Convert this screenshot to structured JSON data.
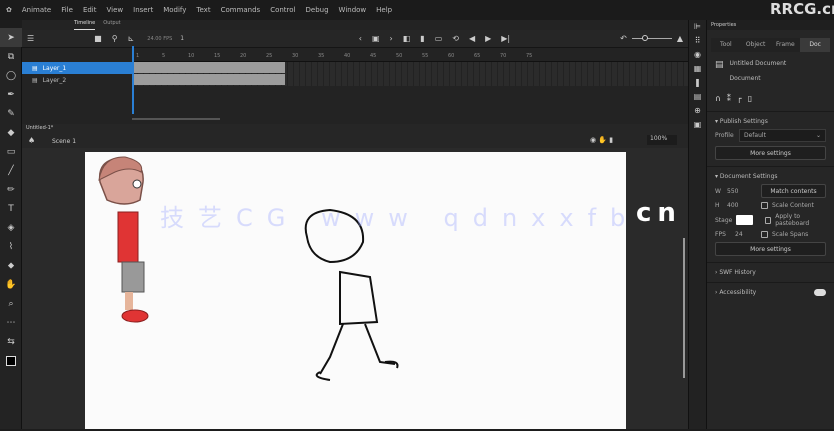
{
  "menu": {
    "app": "Animate",
    "items": [
      "File",
      "Edit",
      "View",
      "Insert",
      "Modify",
      "Text",
      "Commands",
      "Control",
      "Debug",
      "Window",
      "Help"
    ]
  },
  "timeline": {
    "tabs": [
      "Timeline",
      "Output"
    ],
    "fps": "24.00 FPS",
    "frame": "1",
    "frame_numbers": [
      "1",
      "5",
      "10",
      "15",
      "20",
      "25",
      "30",
      "35",
      "40",
      "45",
      "50",
      "55",
      "60",
      "65",
      "70",
      "75"
    ],
    "layers": [
      {
        "name": "Layer_1",
        "selected": true
      },
      {
        "name": "Layer_2",
        "selected": false
      }
    ]
  },
  "stage": {
    "doc_tab": "Untitled-1*",
    "scene": "Scene 1",
    "zoom": "100%"
  },
  "properties": {
    "title": "Properties",
    "tabs": [
      "Tool",
      "Object",
      "Frame",
      "Doc"
    ],
    "active_tab": "Doc",
    "doc_name": "Untitled Document",
    "doc_type": "Document",
    "publish_section": "Publish Settings",
    "profile_label": "Profile",
    "profile_value": "Default",
    "more_settings": "More settings",
    "doc_section": "Document Settings",
    "w_label": "W",
    "w_value": "550",
    "h_label": "H",
    "h_value": "400",
    "match_contents": "Match contents",
    "stage_label": "Stage",
    "stage_color": "#ffffff",
    "fps_label": "FPS",
    "fps_value": "24",
    "scale_content": "Scale Content",
    "apply_pasteboard": "Apply to pasteboard",
    "scale_spans": "Scale Spans",
    "more_settings2": "More settings",
    "swf_history": "SWF History",
    "accessibility": "Accessibility"
  },
  "watermark": {
    "text": "技艺CG www qdnxxfb",
    "suffix": "cn",
    "logo": "RRCG.cn"
  },
  "colors": {
    "accent": "#2a7fd4",
    "bg": "#1d1d1d"
  }
}
